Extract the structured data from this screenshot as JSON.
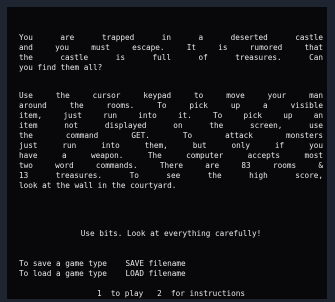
{
  "intro": {
    "lines": [
      "You are trapped in a deserted castle",
      "and you must escape. It is rumored that",
      "the castle is full of treasures. Can",
      "you find them all?"
    ]
  },
  "instructions": {
    "lines": [
      "Use the cursor keypad to move your man",
      "around the rooms. To pick up a visible",
      "item, just run into it. To pick up an",
      "item not displayed on the screen, use",
      "the command GET. To attack monsters",
      "just run into them, but only if you",
      "have a weapon. The computer accepts most",
      "two word commands. There are 83 rooms &",
      "13 treasures. To see the high score,",
      "look at the wall in the courtyard."
    ]
  },
  "tip": {
    "text": "Use bits. Look at everything carefully!"
  },
  "save_load": {
    "lines": [
      "To save a game type    SAVE filename",
      "To load a game type    LOAD filename"
    ]
  },
  "bottom": {
    "text": "1  to play   2  for instructions"
  }
}
